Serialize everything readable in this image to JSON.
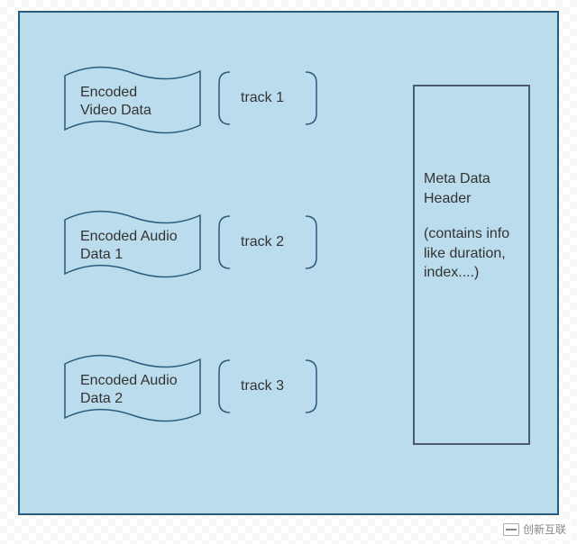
{
  "tracks": [
    {
      "data_label": "Encoded\nVideo Data",
      "track_label": "track 1"
    },
    {
      "data_label": "Encoded Audio\nData 1",
      "track_label": "track 2"
    },
    {
      "data_label": "Encoded Audio\nData 2",
      "track_label": "track 3"
    }
  ],
  "meta": {
    "title": "Meta Data Header",
    "description": "(contains info like duration, index....)"
  },
  "watermark": "创新互联"
}
